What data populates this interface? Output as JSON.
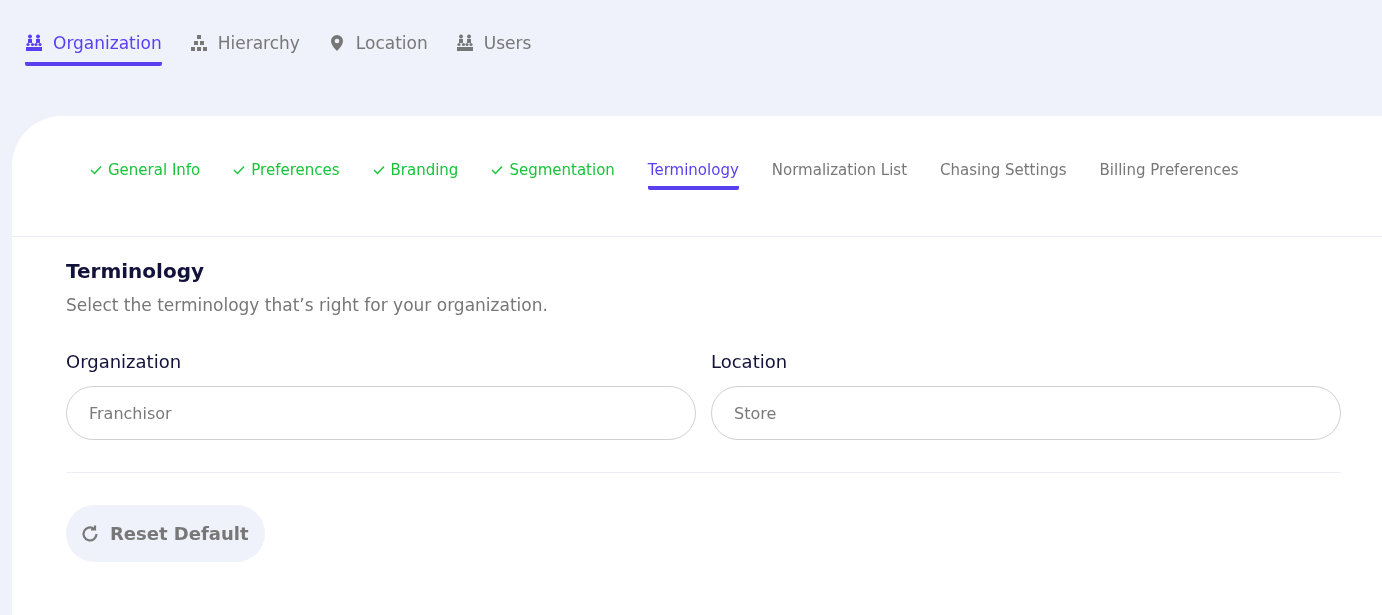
{
  "main_tabs": [
    {
      "label": "Organization",
      "kind": "group",
      "selected": true
    },
    {
      "label": "Hierarchy",
      "kind": "tree",
      "selected": false
    },
    {
      "label": "Location",
      "kind": "place",
      "selected": false
    },
    {
      "label": "Users",
      "kind": "group",
      "selected": false
    }
  ],
  "steps": [
    {
      "label": "General Info",
      "completed": true,
      "selected": false
    },
    {
      "label": "Preferences",
      "completed": true,
      "selected": false
    },
    {
      "label": "Branding",
      "completed": true,
      "selected": false
    },
    {
      "label": "Segmentation",
      "completed": true,
      "selected": false
    },
    {
      "label": "Terminology",
      "completed": false,
      "selected": true
    },
    {
      "label": "Normalization List",
      "completed": false,
      "selected": false
    },
    {
      "label": "Chasing Settings",
      "completed": false,
      "selected": false
    },
    {
      "label": "Billing Preferences",
      "completed": false,
      "selected": false
    }
  ],
  "section": {
    "title": "Terminology",
    "description": "Select the terminology that’s right for your organization."
  },
  "fields": [
    {
      "label": "Organization",
      "placeholder": "Franchisor"
    },
    {
      "label": "Location",
      "placeholder": "Store"
    }
  ],
  "reset_button": "Reset Default"
}
